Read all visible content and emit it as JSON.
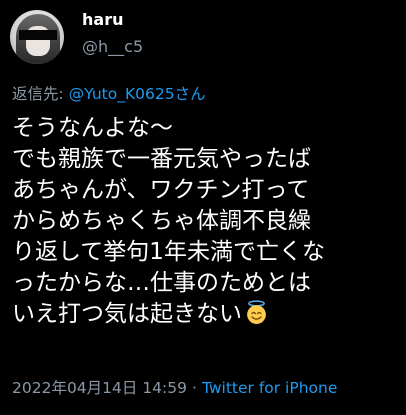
{
  "tweet": {
    "display_name": "haru",
    "username": "@h__c5",
    "reply_prefix": "返信先: ",
    "reply_to": "@Yuto_K0625さん",
    "lines": [
      "そうなんよな〜",
      "でも親族で一番元気やったば",
      "あちゃんが、ワクチン打って",
      "からめちゃくちゃ体調不良繰",
      "り返して挙句1年未満で亡くな",
      "ったからな…仕事のためとは",
      "いえ打つ気は起きない"
    ],
    "emoji_icon": "smiling-face-with-halo-icon",
    "timestamp": "2022年04月14日 14:59",
    "separator": "·",
    "source": "Twitter for iPhone"
  },
  "colors": {
    "background": "#000000",
    "text": "#ffffff",
    "secondary": "#8b98a5",
    "link": "#1d9bf0"
  }
}
